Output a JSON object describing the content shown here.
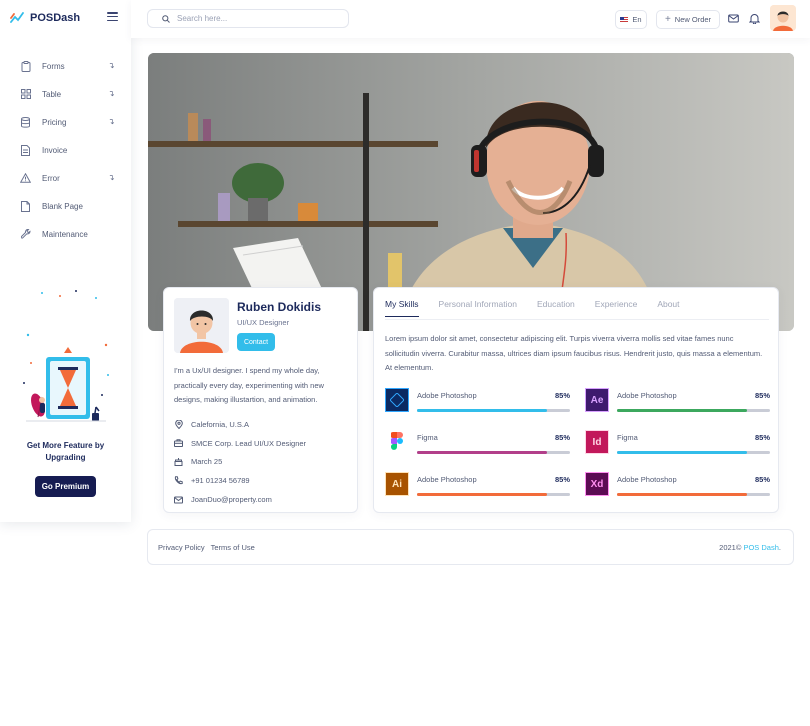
{
  "brand": {
    "name": "POSDash"
  },
  "sidebar": {
    "items": [
      {
        "label": "Forms",
        "icon": "clipboard-icon",
        "has_arrow": true
      },
      {
        "label": "Table",
        "icon": "grid-icon",
        "has_arrow": true
      },
      {
        "label": "Pricing",
        "icon": "database-icon",
        "has_arrow": true
      },
      {
        "label": "Invoice",
        "icon": "file-icon",
        "has_arrow": false
      },
      {
        "label": "Error",
        "icon": "warning-icon",
        "has_arrow": true
      },
      {
        "label": "Blank Page",
        "icon": "page-icon",
        "has_arrow": false
      },
      {
        "label": "Maintenance",
        "icon": "wrench-icon",
        "has_arrow": false
      }
    ],
    "arrow_glyph": "↴",
    "promo": {
      "text": "Get More Feature by Upgrading",
      "button": "Go Premium"
    }
  },
  "topbar": {
    "search_placeholder": "Search here...",
    "language": "En",
    "new_order": "New Order"
  },
  "profile": {
    "name": "Ruben Dokidis",
    "role": "UI/UX Designer",
    "contact_button": "Contact",
    "bio": "I'm a Ux/UI designer. I spend my whole day, practically every day, experimenting with new designs, making illustartion, and animation.",
    "details": [
      {
        "icon": "location-icon",
        "text": "Calefornia, U.S.A"
      },
      {
        "icon": "briefcase-icon",
        "text": "SMCE Corp. Lead UI/UX Designer"
      },
      {
        "icon": "calendar-icon",
        "text": "March 25"
      },
      {
        "icon": "phone-icon",
        "text": "+91 01234 56789"
      },
      {
        "icon": "mail-icon",
        "text": "JoanDuo@property.com"
      }
    ]
  },
  "skills_panel": {
    "tabs": [
      "My Skills",
      "Personal Information",
      "Education",
      "Experience",
      "About"
    ],
    "active_tab": 0,
    "description": "Lorem ipsum dolor sit amet, consectetur adipiscing elit. Turpis viverra viverra mollis sed vitae fames nunc sollicitudin viverra. Curabitur massa, ultrices diam ipsum faucibus risus. Hendrerit justo, quis massa a elementum. At elementum.",
    "skills": [
      {
        "name": "Adobe Photoshop",
        "percent_label": "85%",
        "progress": 0.85,
        "logo_text": "",
        "logo_bg": "#0b2a63",
        "logo_fg": "#31a8ff",
        "bar_color": "#32bdea"
      },
      {
        "name": "Adobe Photoshop",
        "percent_label": "85%",
        "progress": 0.85,
        "logo_text": "Ae",
        "logo_bg": "#3e1a6e",
        "logo_fg": "#d8a1ff",
        "bar_color": "#3ca85e"
      },
      {
        "name": "Figma",
        "percent_label": "85%",
        "progress": 0.85,
        "logo_text": "",
        "logo_bg": "#ffffff",
        "logo_fg": "#f24e1e",
        "bar_color": "#b23f8a"
      },
      {
        "name": "Figma",
        "percent_label": "85%",
        "progress": 0.85,
        "logo_text": "Id",
        "logo_bg": "#c2185b",
        "logo_fg": "#ffd6e6",
        "bar_color": "#32bdea"
      },
      {
        "name": "Adobe Photoshop",
        "percent_label": "85%",
        "progress": 0.85,
        "logo_text": "Ai",
        "logo_bg": "#a85300",
        "logo_fg": "#ffe3b8",
        "bar_color": "#f26b3a"
      },
      {
        "name": "Adobe Photoshop",
        "percent_label": "85%",
        "progress": 0.85,
        "logo_text": "Xd",
        "logo_bg": "#5c0c54",
        "logo_fg": "#ff8ff0",
        "bar_color": "#f26b3a"
      }
    ]
  },
  "footer": {
    "privacy": "Privacy Policy",
    "terms": "Terms of Use",
    "year": "2021©",
    "brand_link": "POS Dash",
    "brand_suffix": "."
  },
  "colors": {
    "accent": "#32bdea",
    "navy": "#1d2a5c",
    "button_dark": "#161c52"
  }
}
